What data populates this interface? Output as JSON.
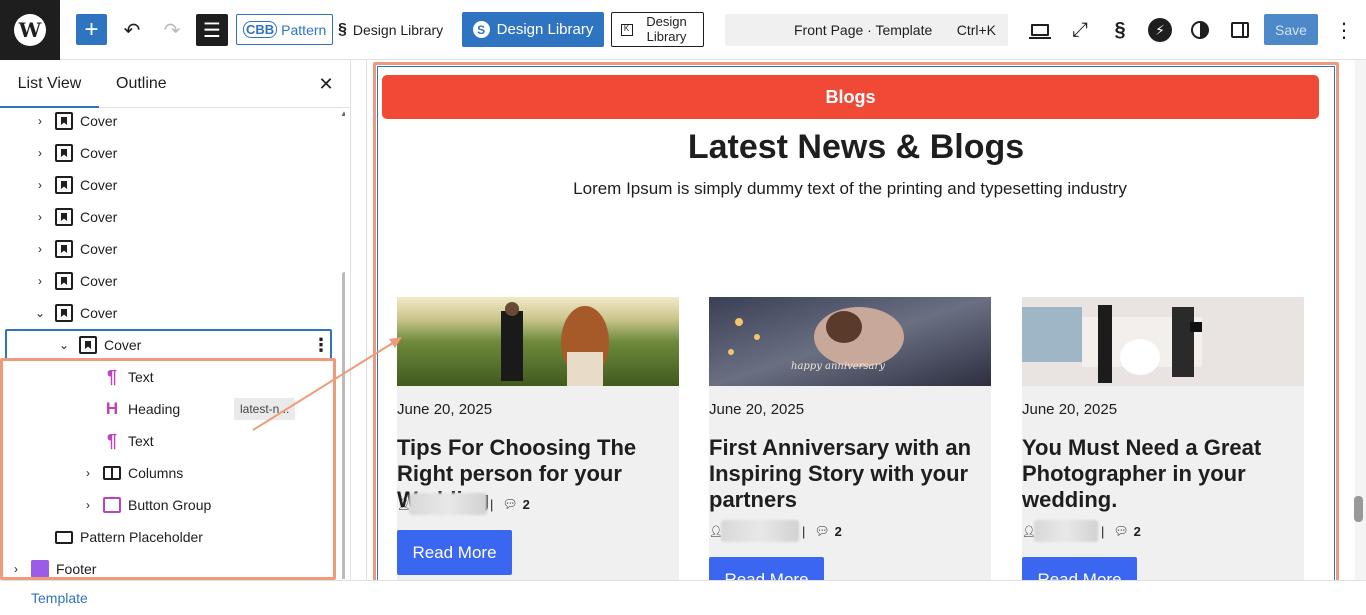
{
  "toolbar": {
    "add_label": "+",
    "cbb_icon_text": "CBB",
    "cbb_label": "Pattern",
    "design_library_1": "Design Library",
    "design_library_2": "Design Library",
    "design_library_3": "Design Library",
    "command_title": "Front Page · Template",
    "command_shortcut": "Ctrl+K",
    "save_label": "Save"
  },
  "panel": {
    "tab_list": "List View",
    "tab_outline": "Outline",
    "tree": [
      {
        "label": "Cover"
      },
      {
        "label": "Cover"
      },
      {
        "label": "Cover"
      },
      {
        "label": "Cover"
      },
      {
        "label": "Cover"
      },
      {
        "label": "Cover"
      },
      {
        "label": "Cover"
      },
      {
        "label": "Cover"
      },
      {
        "label": "Text"
      },
      {
        "label": "Heading",
        "badge": "latest-n..."
      },
      {
        "label": "Text"
      },
      {
        "label": "Columns"
      },
      {
        "label": "Button Group"
      },
      {
        "label": "Pattern Placeholder"
      },
      {
        "label": "Footer"
      }
    ]
  },
  "breadcrumb": "Template",
  "canvas": {
    "pill_label": "Blogs",
    "title": "Latest News & Blogs",
    "subtitle": "Lorem Ipsum is simply dummy text of the printing and typesetting industry",
    "cards": [
      {
        "date": "June 20, 2025",
        "title": "Tips For Choosing The Right person for your Wedding",
        "comments": "2",
        "button": "Read More"
      },
      {
        "date": "June 20, 2025",
        "title": "First Anniversary with an Inspiring Story with your partners",
        "comments": "2",
        "button": "Read More"
      },
      {
        "date": "June 20, 2025",
        "title": "You Must Need a Great Photographer in your wedding.",
        "comments": "2",
        "button": "Read More"
      }
    ]
  },
  "colors": {
    "accent": "#2f74c0",
    "pill": "#f04a37",
    "read_more": "#3a66f0",
    "highlight": "#ef9a7a"
  },
  "icons": [
    "wordpress-logo-icon",
    "add-icon",
    "undo-icon",
    "redo-icon",
    "list-view-icon",
    "stackable-icon",
    "design-library-icon",
    "kadence-icon",
    "laptop-preview-icon",
    "fullscreen-icon",
    "bolt-icon",
    "contrast-icon",
    "sidebar-icon",
    "more-vertical-icon",
    "close-icon",
    "chevron-right-icon",
    "chevron-down-icon",
    "cover-block-icon",
    "paragraph-icon",
    "heading-icon",
    "columns-icon",
    "buttons-icon",
    "pattern-placeholder-icon",
    "footer-icon",
    "user-icon",
    "comment-icon"
  ]
}
